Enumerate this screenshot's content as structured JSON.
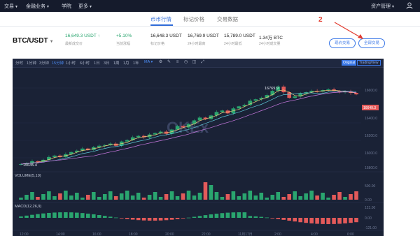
{
  "topnav": {
    "items": [
      {
        "label": "交易"
      },
      {
        "label": "金融业务"
      },
      {
        "label": "学院"
      },
      {
        "label": "更多"
      }
    ],
    "asset_label": "资产管理"
  },
  "subtabs": [
    "币币行情",
    "标记价格",
    "交易数据"
  ],
  "market": {
    "pair": "BTC/USDT",
    "last_price": "16,649.3 USDT",
    "last_price_label": "最新成交价",
    "change": "+5.10%",
    "change_label": "当前涨幅",
    "mark_price": "16,648.3 USDT",
    "mark_price_label": "标记价格",
    "high": "16,769.9 USDT",
    "high_label": "24小时最高",
    "low": "15,789.0 USDT",
    "low_label": "24小时最低",
    "volume": "1.34万 BTC",
    "volume_label": "24小时成交量"
  },
  "buttons": {
    "leverage": "现价交易",
    "all": "全部交易"
  },
  "annotation": "2",
  "colors": {
    "accent": "#2f6bd8",
    "up": "#2aa56f",
    "down": "#e35a5a",
    "annotation": "#e23b2e"
  },
  "chart_toolbar": {
    "timeframes": [
      "分时",
      "1分钟",
      "3分钟",
      "15分钟",
      "1小时",
      "6小时",
      "1日",
      "3日",
      "1周",
      "1月",
      "1年"
    ],
    "active_timeframe": "15分钟",
    "indicator": "MA",
    "view_original": "Original",
    "view_tradingview": "TradingView"
  },
  "chart_labels": {
    "max_label": "16769.9",
    "min_label": "15645.4",
    "price_tag": "16649.3",
    "volume_label": "VOLUME(5,10)",
    "macd_label": "MACD(12,26,9)",
    "watermark": "OKEx",
    "price_axis": [
      "16600.0",
      "16400.0",
      "16200.0",
      "16000.0",
      "15800.0"
    ],
    "volume_axis": [
      "500.00",
      "0.00"
    ],
    "macd_axis": [
      "121.00",
      "0.00",
      "-121.00"
    ],
    "time_axis": [
      "12:00",
      "14:00",
      "16:00",
      "18:00",
      "20:00",
      "22:00",
      "11月17日",
      "2:00",
      "4:00",
      "6:00"
    ]
  },
  "chart_data": {
    "type": "candlestick",
    "interval": "15分钟",
    "close_series": [
      15660,
      15670,
      15700,
      15690,
      15720,
      15760,
      15780,
      15760,
      15800,
      15830,
      15850,
      15880,
      15860,
      15900,
      15920,
      15930,
      15950,
      15920,
      15980,
      16000,
      16040,
      16060,
      16040,
      16080,
      16100,
      16120,
      16090,
      16150,
      16200,
      16180,
      16230,
      16280,
      16320,
      16300,
      16350,
      16400,
      16420,
      16380,
      16450,
      16480,
      16500,
      16560,
      16580,
      16600,
      16640,
      16700,
      16760,
      16680,
      16600,
      16620,
      16660,
      16680,
      16700,
      16690,
      16710,
      16720,
      16700,
      16680,
      16690,
      16670,
      16650
    ]
  }
}
